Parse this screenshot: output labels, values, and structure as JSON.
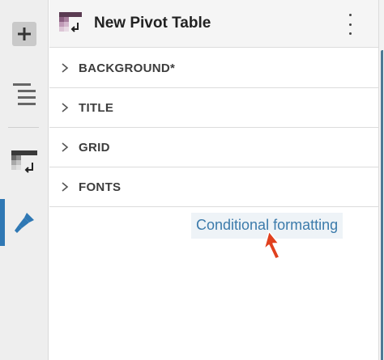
{
  "rail": {
    "items": [
      {
        "name": "add",
        "icon": "plus-icon"
      },
      {
        "name": "layers",
        "icon": "layers-icon"
      },
      {
        "name": "pivot-table",
        "icon": "pivot-table-icon"
      },
      {
        "name": "format",
        "icon": "paintbrush-icon",
        "active": true
      }
    ]
  },
  "header": {
    "title": "New Pivot Table",
    "icon": "pivot-table-icon",
    "more_icon": "vertical-ellipsis-icon"
  },
  "sections": [
    {
      "label": "BACKGROUND*"
    },
    {
      "label": "TITLE"
    },
    {
      "label": "GRID"
    },
    {
      "label": "FONTS"
    }
  ],
  "conditional_formatting": {
    "label": "Conditional formatting"
  },
  "colors": {
    "accent": "#2f78b4",
    "link": "#3c7bab",
    "cursor": "#e0401e"
  }
}
